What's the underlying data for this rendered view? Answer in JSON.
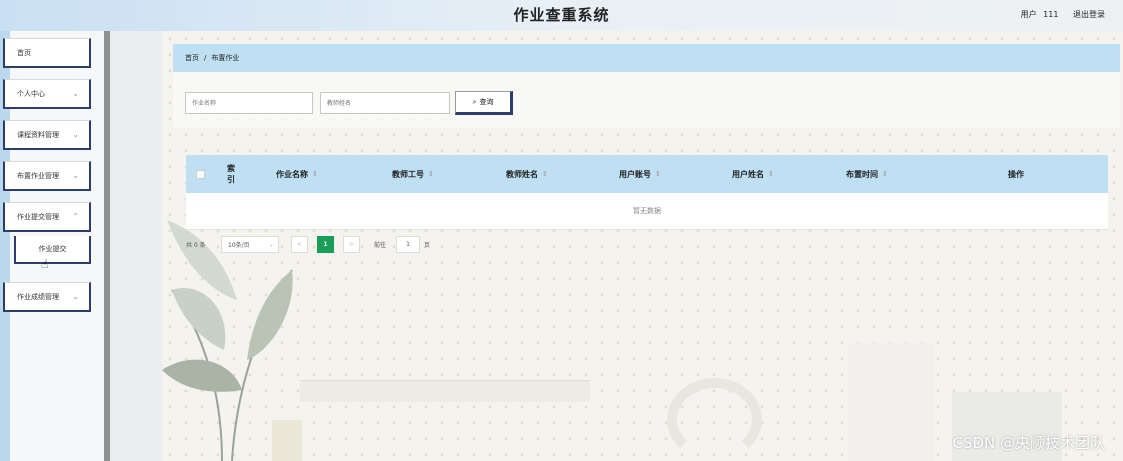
{
  "header": {
    "title": "作业查重系统",
    "user_label": "用户",
    "user_id": "111",
    "logout": "退出登录"
  },
  "sidebar": {
    "items": [
      {
        "label": "首页",
        "has_children": false
      },
      {
        "label": "个人中心",
        "has_children": true
      },
      {
        "label": "课程资料管理",
        "has_children": true
      },
      {
        "label": "布置作业管理",
        "has_children": true
      },
      {
        "label": "作业提交管理",
        "has_children": true
      },
      {
        "label": "作业提交",
        "is_submenu": true
      },
      {
        "label": "作业成绩管理",
        "has_children": true
      }
    ]
  },
  "breadcrumb": {
    "home": "首页",
    "separator": "/",
    "current": "布置作业"
  },
  "search": {
    "homework_name_placeholder": "作业名称",
    "teacher_name_placeholder": "教师姓名",
    "search_button": "查询"
  },
  "table": {
    "columns": [
      "索引",
      "作业名称",
      "教师工号",
      "教师姓名",
      "用户账号",
      "用户姓名",
      "布置时间",
      "操作"
    ],
    "index_col": [
      "索",
      "引"
    ],
    "empty_text": "暂无数据"
  },
  "pagination": {
    "total": "共 0 条",
    "page_size": "10条/页",
    "prev": "<",
    "current_page": "1",
    "next": ">",
    "goto_label": "前往",
    "goto_value": "1",
    "page_unit": "页"
  },
  "watermark": "CSDN @央顺技术团队",
  "colors": {
    "header_blue": "#bfe0f3",
    "sidebar_border": "#2f3d6b",
    "page_active": "#1a9e57"
  }
}
